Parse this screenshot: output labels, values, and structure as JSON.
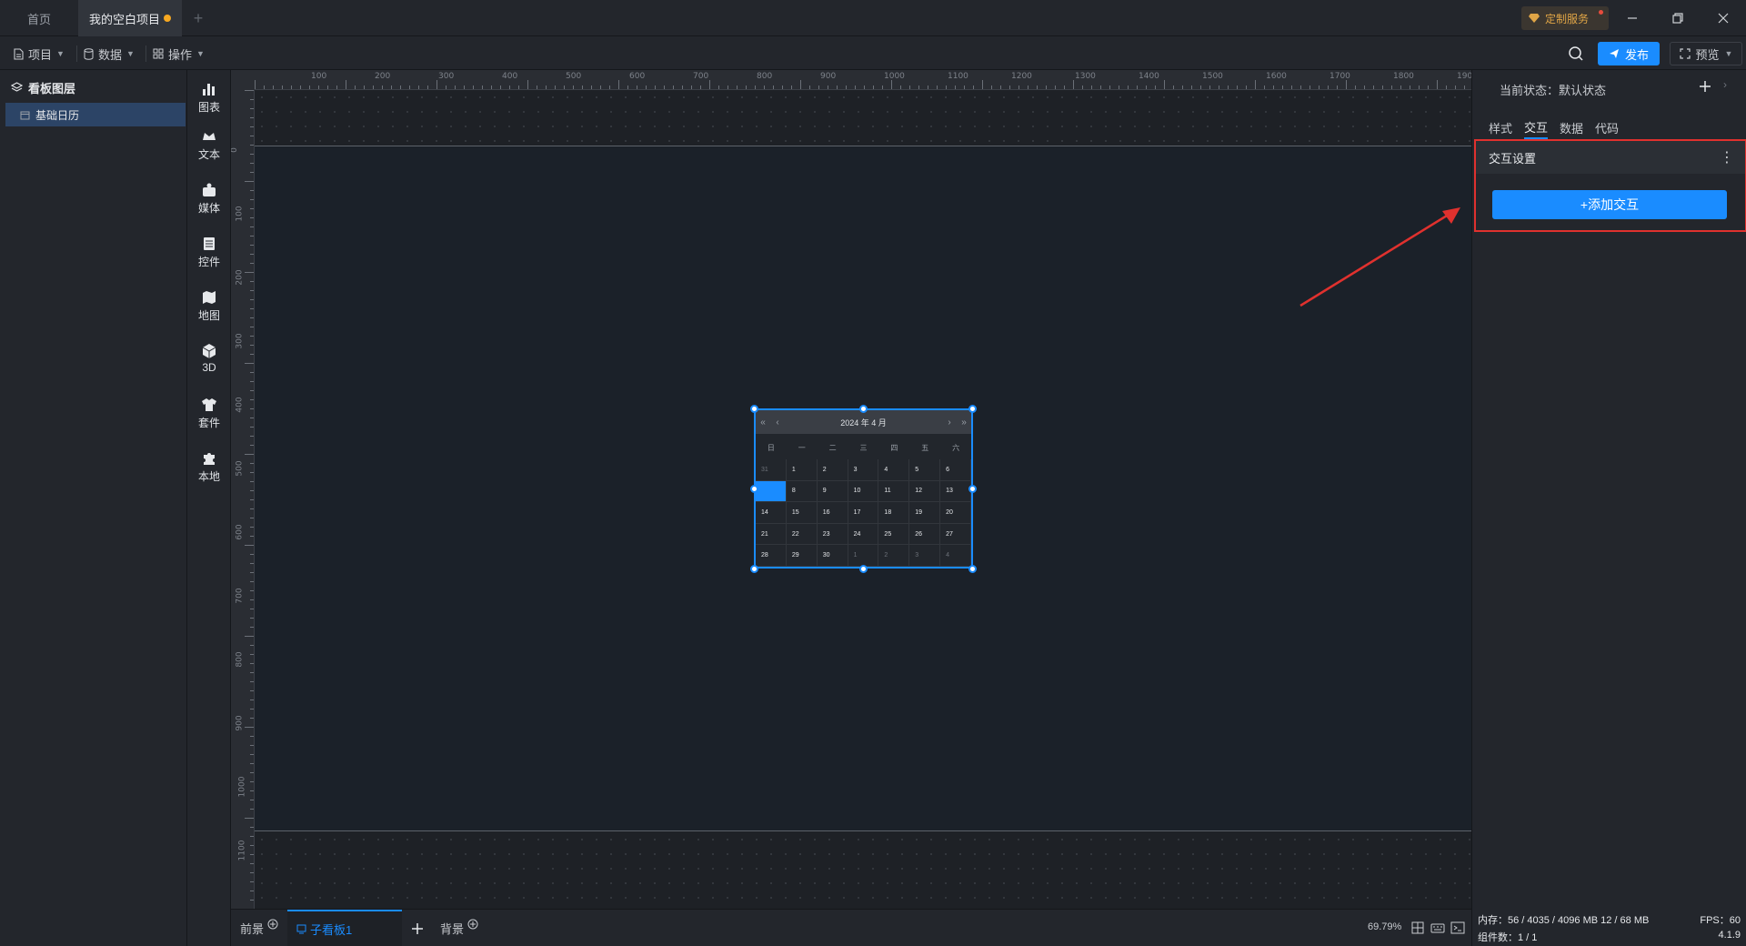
{
  "tabs": {
    "home": "首页",
    "project": "我的空白项目",
    "add": "+"
  },
  "title_bar": {
    "service": "定制服务"
  },
  "toolbar": {
    "menu_project": "项目",
    "menu_data": "数据",
    "menu_ops": "操作",
    "publish": "发布",
    "preview": "预览"
  },
  "layers": {
    "title": "看板图层",
    "items": [
      "基础日历"
    ]
  },
  "components": [
    {
      "label": "图表",
      "icon": "bar-chart-icon"
    },
    {
      "label": "文本",
      "icon": "text-icon"
    },
    {
      "label": "媒体",
      "icon": "media-icon"
    },
    {
      "label": "控件",
      "icon": "control-icon"
    },
    {
      "label": "地图",
      "icon": "map-icon"
    },
    {
      "label": "3D",
      "icon": "cube-icon"
    },
    {
      "label": "套件",
      "icon": "kit-icon"
    },
    {
      "label": "本地",
      "icon": "puzzle-icon"
    }
  ],
  "ruler": {
    "top": [
      "100",
      "200",
      "300",
      "400",
      "500",
      "600",
      "700",
      "800",
      "900",
      "1000",
      "1100",
      "1200",
      "1300",
      "1400",
      "1500",
      "1600",
      "1700",
      "1800",
      "1900"
    ],
    "left": [
      "0",
      "100",
      "200",
      "300",
      "400",
      "500",
      "600",
      "700",
      "800",
      "900",
      "1000",
      "1100"
    ]
  },
  "calendar": {
    "title": "2024 年 4 月",
    "nav": [
      "«",
      "‹",
      "›",
      "»"
    ],
    "weekdays": [
      "日",
      "一",
      "二",
      "三",
      "四",
      "五",
      "六"
    ],
    "days": [
      {
        "d": "31",
        "other": true
      },
      {
        "d": "1"
      },
      {
        "d": "2"
      },
      {
        "d": "3"
      },
      {
        "d": "4"
      },
      {
        "d": "5"
      },
      {
        "d": "6"
      },
      {
        "d": "",
        "selected": true
      },
      {
        "d": "8"
      },
      {
        "d": "9"
      },
      {
        "d": "10"
      },
      {
        "d": "11"
      },
      {
        "d": "12"
      },
      {
        "d": "13"
      },
      {
        "d": "14"
      },
      {
        "d": "15"
      },
      {
        "d": "16"
      },
      {
        "d": "17"
      },
      {
        "d": "18"
      },
      {
        "d": "19"
      },
      {
        "d": "20"
      },
      {
        "d": "21"
      },
      {
        "d": "22"
      },
      {
        "d": "23"
      },
      {
        "d": "24"
      },
      {
        "d": "25"
      },
      {
        "d": "26"
      },
      {
        "d": "27"
      },
      {
        "d": "28"
      },
      {
        "d": "29"
      },
      {
        "d": "30"
      },
      {
        "d": "1",
        "other": true
      },
      {
        "d": "2",
        "other": true
      },
      {
        "d": "3",
        "other": true
      },
      {
        "d": "4",
        "other": true
      }
    ]
  },
  "bottom": {
    "foreground": "前景",
    "subboard": "子看板1",
    "background": "背景",
    "zoom": "69.79%"
  },
  "right_panel": {
    "state": "当前状态：默认状态",
    "tabs": [
      "样式",
      "交互",
      "数据",
      "代码"
    ],
    "interact_title": "交互设置",
    "add_interact": "+添加交互"
  },
  "status": {
    "memory": "内存：56 / 4035 / 4096 MB  12 / 68 MB",
    "fps": "FPS：60",
    "count": "组件数：1 / 1",
    "version": "4.1.9"
  },
  "colors": {
    "accent": "#1a8cff",
    "annotation": "#e0312e",
    "unsaved_dot": "#f6a821"
  }
}
